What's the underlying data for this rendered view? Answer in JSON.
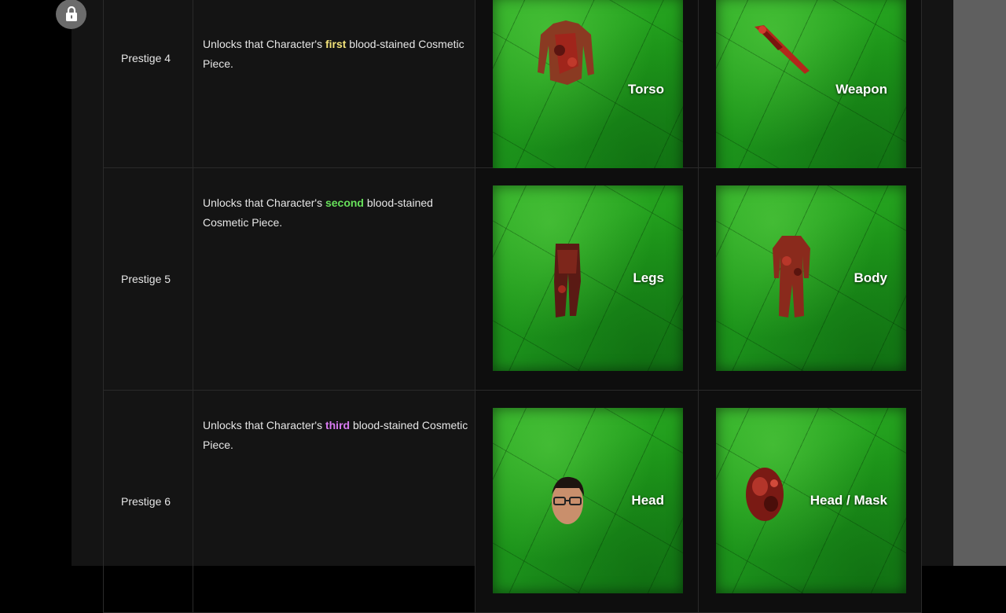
{
  "rows": [
    {
      "level": "Prestige 4",
      "desc_prefix": "Unlocks that Character's ",
      "highlight": "first",
      "desc_suffix": " blood-stained Cosmetic Piece.",
      "cards": [
        {
          "label": "Torso",
          "icon": "bloody-torso-shirt-icon"
        },
        {
          "label": "Weapon",
          "icon": "bloody-weapon-blade-icon"
        }
      ]
    },
    {
      "level": "Prestige 5",
      "desc_prefix": "Unlocks that Character's ",
      "highlight": "second",
      "desc_suffix": " blood-stained Cosmetic Piece.",
      "cards": [
        {
          "label": "Legs",
          "icon": "bloody-legs-pants-icon"
        },
        {
          "label": "Body",
          "icon": "bloody-body-outfit-icon"
        }
      ]
    },
    {
      "level": "Prestige 6",
      "desc_prefix": "Unlocks that Character's ",
      "highlight": "third",
      "desc_suffix": " blood-stained Cosmetic Piece.",
      "cards": [
        {
          "label": "Head",
          "icon": "survivor-head-glasses-icon"
        },
        {
          "label": "Head / Mask",
          "icon": "bloody-head-mask-icon"
        }
      ]
    }
  ],
  "colors": {
    "first": "#f3e37a",
    "second": "#67e05a",
    "third": "#d97bf2",
    "card_green": "#1f9a1b"
  },
  "icons": {
    "lock": "lock-icon"
  }
}
